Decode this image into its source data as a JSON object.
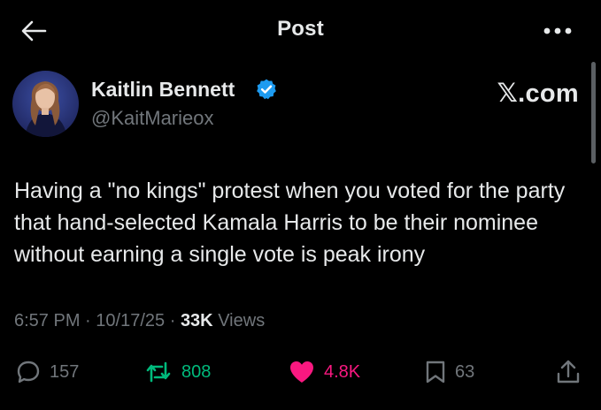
{
  "header": {
    "title": "Post"
  },
  "author": {
    "name": "Kaitlin Bennett",
    "handle": "@KaitMarieox",
    "verified": true
  },
  "source": "𝕏.com",
  "tweet": {
    "text": "Having a \"no kings\" protest when you voted for the party that hand-selected Kamala Harris to be their nominee without earning a single vote is peak irony"
  },
  "meta": {
    "time": "6:57 PM",
    "sep1": "·",
    "date": "10/17/25",
    "sep2": "·",
    "views_count": "33K",
    "views_label": "Views"
  },
  "actions": {
    "replies": "157",
    "reposts": "808",
    "likes": "4.8K",
    "bookmarks": "63"
  },
  "colors": {
    "background": "#000000",
    "text": "#e7e9ea",
    "muted": "#71767b",
    "verified": "#1d9bf0",
    "repost": "#00ba7c",
    "like": "#f91880"
  }
}
